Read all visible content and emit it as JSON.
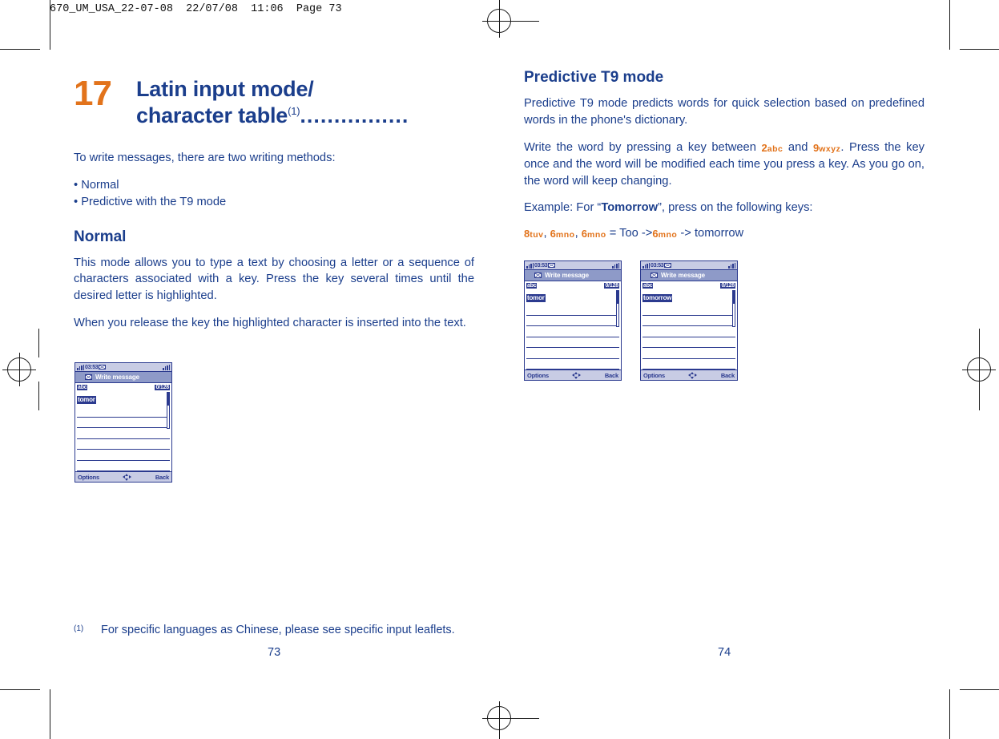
{
  "slug": "670_UM_USA_22-07-08  22/07/08  11:06  Page 73",
  "left_column": {
    "chapter_number": "17",
    "chapter_title_line1": "Latin input mode/",
    "chapter_title_line2": "character table",
    "chapter_title_sup": "(1)",
    "chapter_title_dots": "................",
    "intro": "To write messages, there are two writing methods:",
    "bullets": [
      "• Normal",
      "• Predictive with the T9 mode"
    ],
    "section_normal": "Normal",
    "para_normal_1": "This mode allows you to type a text by choosing a letter or a sequence of characters associated with a key. Press the key several times until the desired letter is highlighted.",
    "para_normal_2": "When you release the key the highlighted character is inserted into the text."
  },
  "right_column": {
    "section_t9": "Predictive T9 mode",
    "para_1": "Predictive T9 mode predicts words for quick selection based on predefined words in the phone's dictionary.",
    "para_2_pre": "Write the word by pressing a key between",
    "para_2_key1_num": "2",
    "para_2_key1_let": "abc",
    "para_2_mid": "and",
    "para_2_key2_num": "9",
    "para_2_key2_let": "wxyz",
    "para_2_post": ". Press the key once and the word will be modified each time you press a key. As you go on, the word will keep changing.",
    "example_pre": "Example: For “",
    "example_word": "Tomorrow",
    "example_post": "”, press on the following keys:",
    "keyseq": {
      "k1_num": "8",
      "k1_let": "tuv",
      "sep1": ",",
      "k2_num": "6",
      "k2_let": "mno",
      "sep2": ",",
      "k3_num": "6",
      "k3_let": "mno",
      "eq": "= Too ->",
      "k4_num": "6",
      "k4_let": "mno",
      "arrow": "-> tomorrow"
    }
  },
  "screenshots": [
    {
      "id": "normal-mode-screen",
      "time": "03:53",
      "title": "Write message",
      "mode": "abc",
      "counter": "0/128",
      "word": "tomor",
      "softkey_left": "Options",
      "softkey_right": "Back"
    },
    {
      "id": "t9-too-screen",
      "time": "03:53",
      "title": "Write message",
      "mode": "abc",
      "counter": "0/128",
      "word": "tomor",
      "softkey_left": "Options",
      "softkey_right": "Back"
    },
    {
      "id": "t9-tomorrow-screen",
      "time": "03:53",
      "title": "Write message",
      "mode": "abc",
      "counter": "0/128",
      "word": "tomorrow",
      "softkey_left": "Options",
      "softkey_right": "Back"
    }
  ],
  "footnote": {
    "mark": "(1)",
    "text": "For specific languages as Chinese, please see specific input leaflets."
  },
  "folios": {
    "left": "73",
    "right": "74"
  },
  "colors": {
    "blue": "#1b3e8c",
    "orange": "#e2731b",
    "screen_border": "#2b3a8f",
    "screen_title_bar": "#8e9ac8",
    "screen_status_bar": "#c8cce4"
  }
}
